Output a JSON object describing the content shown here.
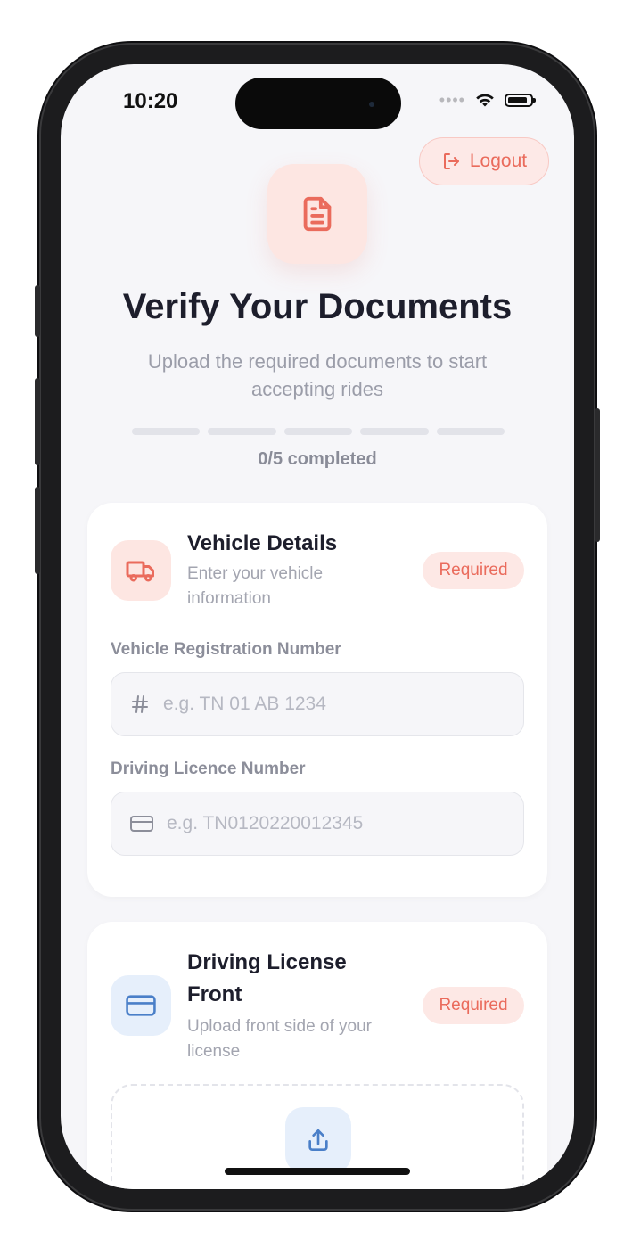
{
  "status_bar": {
    "time": "10:20"
  },
  "header": {
    "logout_label": "Logout",
    "title": "Verify Your Documents",
    "subtitle": "Upload the required documents to start accepting rides"
  },
  "progress": {
    "completed": 0,
    "total": 5,
    "label": "0/5 completed"
  },
  "vehicle_card": {
    "title": "Vehicle Details",
    "description": "Enter your vehicle information",
    "badge": "Required",
    "registration": {
      "label": "Vehicle Registration Number",
      "placeholder": "e.g. TN 01 AB 1234",
      "value": ""
    },
    "licence": {
      "label": "Driving Licence Number",
      "placeholder": "e.g. TN0120220012345",
      "value": ""
    }
  },
  "license_front_card": {
    "title": "Driving License Front",
    "description": "Upload front side of your license",
    "badge": "Required"
  },
  "colors": {
    "accent": "#ea6b5c",
    "accent_bg": "#fde6e2",
    "blue": "#4a7fc8",
    "blue_bg": "#e6effb",
    "text": "#1d1e2c",
    "muted": "#9b9da9"
  },
  "icons": [
    "document-icon",
    "logout-icon",
    "truck-icon",
    "hash-icon",
    "card-icon",
    "upload-icon",
    "wifi-icon",
    "battery-icon"
  ]
}
